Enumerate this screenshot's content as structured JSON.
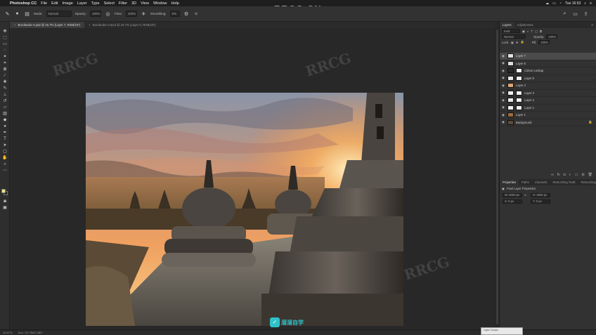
{
  "menubar": {
    "app": "Photoshop CC",
    "menus": [
      "File",
      "Edit",
      "Image",
      "Layer",
      "Type",
      "Select",
      "Filter",
      "3D",
      "View",
      "Window",
      "Help"
    ],
    "clock": "Tue 16:53"
  },
  "watermark": {
    "top": "RRCG.CN",
    "repeated": "RRCG",
    "logo": "溜溜自学"
  },
  "options_bar": {
    "mode_label": "Mode:",
    "mode_value": "Normal",
    "opacity_label": "Opacity:",
    "opacity_value": "100%",
    "flow_label": "Flow:",
    "flow_value": "100%",
    "smoothing_label": "Smoothing:",
    "smoothing_value": "0%"
  },
  "tabs": [
    {
      "label": "Borobudur-4.psd @ 16.7% (Layer 7, RGB/16*)",
      "active": true
    },
    {
      "label": "Borobudur-cutout @ 16.7% (Layer 0, RGB/16*)",
      "active": false
    }
  ],
  "panel": {
    "tabs": [
      "Layers",
      "Adjustments"
    ],
    "kind_label": "Kind",
    "blend_mode": "Normal",
    "opacity_label": "Opacity:",
    "opacity_value": "100%",
    "lock_label": "Lock:",
    "fill_label": "Fill:",
    "fill_value": "100%",
    "layers": [
      {
        "name": "Layer 7",
        "selected": true,
        "has_mask": false,
        "thumb": "#e0e0e0"
      },
      {
        "name": "Layer 6",
        "selected": false,
        "has_mask": false,
        "thumb": "#dcdcdc"
      },
      {
        "name": "Colour Lookup",
        "selected": false,
        "has_mask": true,
        "thumb": "#2a2a2a"
      },
      {
        "name": "Layer 5",
        "selected": false,
        "has_mask": true,
        "thumb": "#e8e8e8"
      },
      {
        "name": "Layer 4",
        "selected": false,
        "has_mask": false,
        "thumb": "#d9a47a"
      },
      {
        "name": "Layer 3",
        "selected": false,
        "has_mask": true,
        "thumb": "#f0f0f0"
      },
      {
        "name": "Layer 2",
        "selected": false,
        "has_mask": true,
        "thumb": "#ececec"
      },
      {
        "name": "Layer 1",
        "selected": false,
        "has_mask": true,
        "thumb": "#efefef"
      },
      {
        "name": "Layer 1",
        "selected": false,
        "has_mask": false,
        "thumb": "#9a6a3e"
      },
      {
        "name": "Background",
        "selected": false,
        "has_mask": false,
        "thumb": "#5a4a3a"
      }
    ],
    "properties_tabs": [
      "Properties",
      "Paths",
      "Channels",
      "Retouching Toolk",
      "Retouching Toolk"
    ],
    "properties_title": "Pixel Layer Properties",
    "props": {
      "w": "W: 6000 px",
      "h": "H: 4000 px",
      "x": "X: 0 px",
      "y": "Y: 0 px"
    }
  },
  "status": {
    "zoom": "16.67%",
    "doc": "Doc: 137.3M/2.38G"
  },
  "mini_window": "Layer Comps"
}
